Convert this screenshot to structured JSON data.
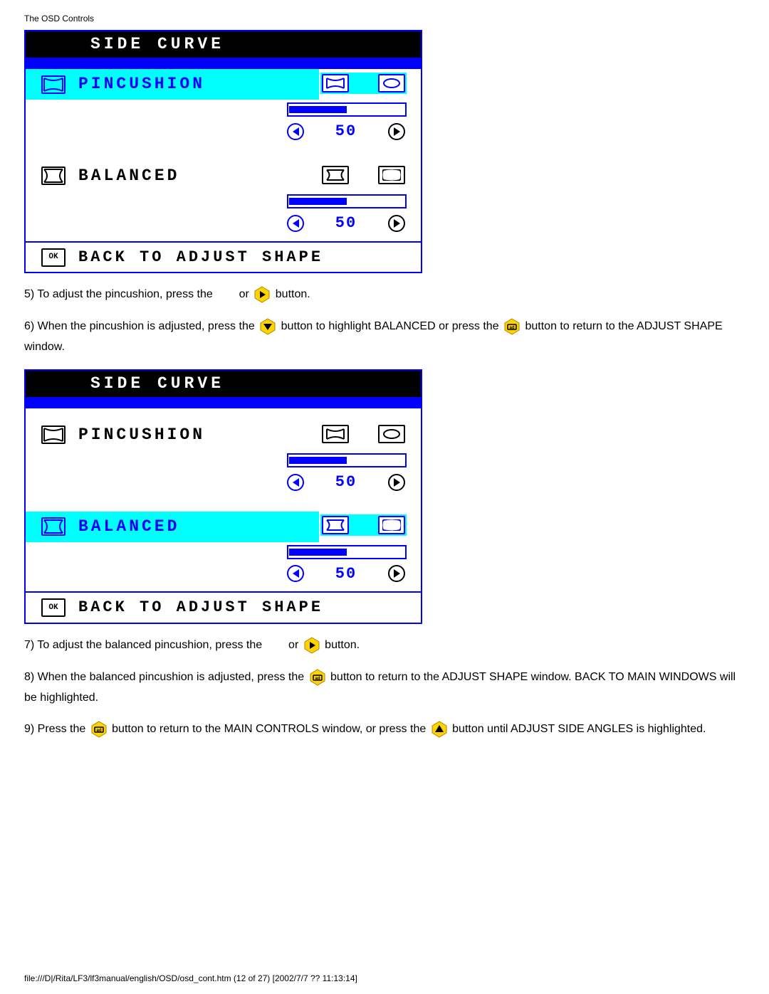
{
  "page": {
    "top_title": "The OSD Controls",
    "footer": "file:///D|/Rita/LF3/lf3manual/english/OSD/osd_cont.htm (12 of 27) [2002/7/7 ?? 11:13:14]"
  },
  "steps": {
    "s5_a": "5) To adjust the pincushion, press the ",
    "s5_b": " or ",
    "s5_c": " button.",
    "s6_a": "6) When the pincushion is adjusted, press the ",
    "s6_b": " button to highlight BALANCED or press the ",
    "s6_c": " button to return to the ADJUST SHAPE window.",
    "s7_a": "7) To adjust the balanced pincushion, press the ",
    "s7_b": " or ",
    "s7_c": " button.",
    "s8_a": "8) When the balanced pincushion is adjusted, press the ",
    "s8_b": " button to return to the ADJUST SHAPE window. BACK TO MAIN WINDOWS will be highlighted.",
    "s9_a": "9) Press the ",
    "s9_b": " button to return to the MAIN CONTROLS window, or press the ",
    "s9_c": " button until ADJUST SIDE ANGLES is highlighted."
  },
  "osd1": {
    "title": "SIDE CURVE",
    "items": [
      {
        "label": "PINCUSHION",
        "value": "50",
        "highlight": true
      },
      {
        "label": "BALANCED",
        "value": "50",
        "highlight": false
      }
    ],
    "footer_ok": "OK",
    "footer_label": "BACK TO ADJUST SHAPE"
  },
  "osd2": {
    "title": "SIDE CURVE",
    "items": [
      {
        "label": "PINCUSHION",
        "value": "50",
        "highlight": false
      },
      {
        "label": "BALANCED",
        "value": "50",
        "highlight": true
      }
    ],
    "footer_ok": "OK",
    "footer_label": "BACK TO ADJUST SHAPE"
  }
}
